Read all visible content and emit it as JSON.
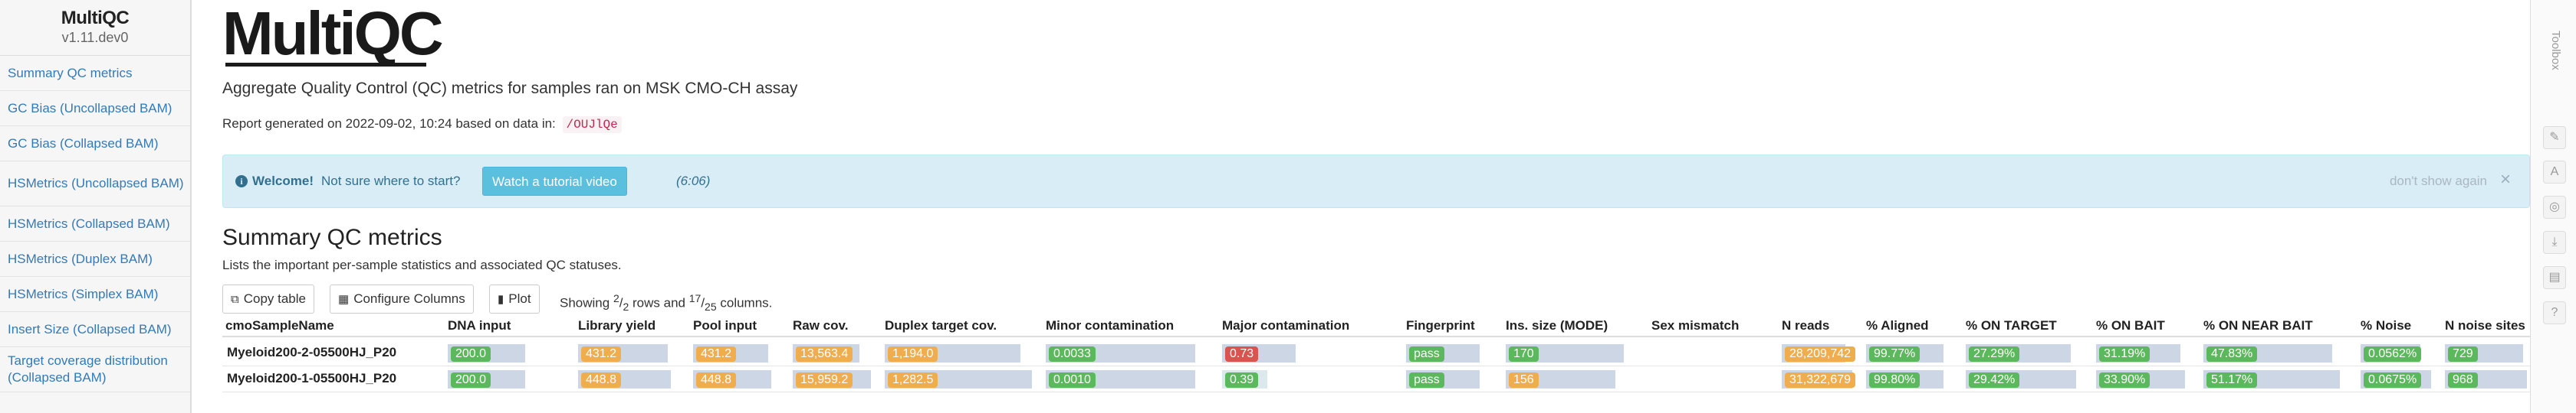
{
  "sidebar": {
    "logo": "MultiQC",
    "version": "v1.11.dev0",
    "items": [
      {
        "label": "Summary QC metrics"
      },
      {
        "label": "GC Bias (Uncollapsed BAM)"
      },
      {
        "label": "GC Bias (Collapsed BAM)"
      },
      {
        "label": "HSMetrics (Uncollapsed BAM)"
      },
      {
        "label": "HSMetrics (Collapsed BAM)"
      },
      {
        "label": "HSMetrics (Duplex BAM)"
      },
      {
        "label": "HSMetrics (Simplex BAM)"
      },
      {
        "label": "Insert Size (Collapsed BAM)"
      },
      {
        "label": "Target coverage distribution (Collapsed BAM)"
      }
    ]
  },
  "header": {
    "logo": "MultiQC",
    "subtitle": "Aggregate Quality Control (QC) metrics for samples ran on MSK CMO-CH assay",
    "report_text": "Report generated on 2022-09-02, 10:24 based on data in:",
    "report_path": "/OUJlQe"
  },
  "welcome": {
    "strong": "Welcome!",
    "text": "Not sure where to start?",
    "button": "Watch a tutorial video",
    "duration": "(6:06)",
    "dismiss": "don't show again",
    "close": "×"
  },
  "section": {
    "title": "Summary QC metrics",
    "description": "Lists the important per-sample statistics and associated QC statuses."
  },
  "toolbar": {
    "copy": "Copy table",
    "configure": "Configure Columns",
    "plot": "Plot",
    "showing_prefix": "Showing",
    "rows_shown": "2",
    "rows_total": "2",
    "rows_word": "rows and",
    "cols_shown": "17",
    "cols_total": "25",
    "cols_word": "columns."
  },
  "colors": {
    "green": "#5cb85c",
    "orange": "#f0ad4e",
    "red": "#d9534f",
    "bar_bg": "#cdd6e4",
    "bar_light": "#dbe9ec"
  },
  "table": {
    "name_header": "cmoSampleName",
    "columns": [
      {
        "header": "DNA input"
      },
      {
        "header": "Library yield"
      },
      {
        "header": "Pool input"
      },
      {
        "header": "Raw cov."
      },
      {
        "header": "Duplex target cov."
      },
      {
        "header": "Minor contamination"
      },
      {
        "header": "Major contamination"
      },
      {
        "header": "Fingerprint"
      },
      {
        "header": "Ins. size (MODE)"
      },
      {
        "header": "Sex mismatch"
      },
      {
        "header": "N reads"
      },
      {
        "header": "% Aligned"
      },
      {
        "header": "% ON TARGET"
      },
      {
        "header": "% ON BAIT"
      },
      {
        "header": "% ON NEAR BAIT"
      },
      {
        "header": "% Noise"
      },
      {
        "header": "N noise sites"
      }
    ],
    "rows": [
      {
        "name": "Myeloid200-2-05500HJ_P20",
        "cells": [
          {
            "value": "200.0",
            "status": "green",
            "fill": 0.9
          },
          {
            "value": "431.2",
            "status": "orange",
            "fill": 0.92
          },
          {
            "value": "431.2",
            "status": "orange",
            "fill": 0.92
          },
          {
            "value": "13,563.4",
            "status": "orange",
            "fill": 0.85
          },
          {
            "value": "1,194.0",
            "status": "orange",
            "fill": 0.92
          },
          {
            "value": "0.0033",
            "status": "green",
            "fill": 0.9
          },
          {
            "value": "0.73",
            "status": "red",
            "fill": 0.9
          },
          {
            "value": "pass",
            "status": "green",
            "fill": 0.9
          },
          {
            "value": "170",
            "status": "green",
            "fill": 0.95
          },
          {
            "value": "",
            "status": "none",
            "fill": 0
          },
          {
            "value": "28,209,742",
            "status": "orange",
            "fill": 0.9
          },
          {
            "value": "99.77%",
            "status": "green",
            "fill": 0.9
          },
          {
            "value": "27.29%",
            "status": "green",
            "fill": 0.9
          },
          {
            "value": "31.19%",
            "status": "green",
            "fill": 0.9
          },
          {
            "value": "47.83%",
            "status": "green",
            "fill": 0.9
          },
          {
            "value": "0.0562%",
            "status": "green",
            "fill": 0.85
          },
          {
            "value": "729",
            "status": "green",
            "fill": 0.95
          }
        ]
      },
      {
        "name": "Myeloid200-1-05500HJ_P20",
        "cells": [
          {
            "value": "200.0",
            "status": "green",
            "fill": 0.9
          },
          {
            "value": "448.8",
            "status": "orange",
            "fill": 0.95
          },
          {
            "value": "448.8",
            "status": "orange",
            "fill": 0.95
          },
          {
            "value": "15,959.2",
            "status": "orange",
            "fill": 1.0
          },
          {
            "value": "1,282.5",
            "status": "orange",
            "fill": 1.0
          },
          {
            "value": "0.0010",
            "status": "green",
            "fill": 0.9
          },
          {
            "value": "0.39",
            "status": "green",
            "fill": 0.55
          },
          {
            "value": "pass",
            "status": "green",
            "fill": 0.9
          },
          {
            "value": "156",
            "status": "orange",
            "fill": 0.88
          },
          {
            "value": "",
            "status": "none",
            "fill": 0
          },
          {
            "value": "31,322,679",
            "status": "orange",
            "fill": 1.0
          },
          {
            "value": "99.80%",
            "status": "green",
            "fill": 0.9
          },
          {
            "value": "29.42%",
            "status": "green",
            "fill": 0.95
          },
          {
            "value": "33.90%",
            "status": "green",
            "fill": 0.95
          },
          {
            "value": "51.17%",
            "status": "green",
            "fill": 0.95
          },
          {
            "value": "0.0675%",
            "status": "green",
            "fill": 1.0
          },
          {
            "value": "968",
            "status": "green",
            "fill": 1.0
          }
        ]
      }
    ]
  },
  "toolbox": {
    "label": "Toolbox",
    "icons": [
      {
        "name": "highlight-icon",
        "glyph": "✎"
      },
      {
        "name": "rename-icon",
        "glyph": "A"
      },
      {
        "name": "hide-icon",
        "glyph": "◎"
      },
      {
        "name": "export-icon",
        "glyph": "⤓"
      },
      {
        "name": "save-icon",
        "glyph": "▤"
      },
      {
        "name": "help-icon",
        "glyph": "?"
      }
    ]
  }
}
